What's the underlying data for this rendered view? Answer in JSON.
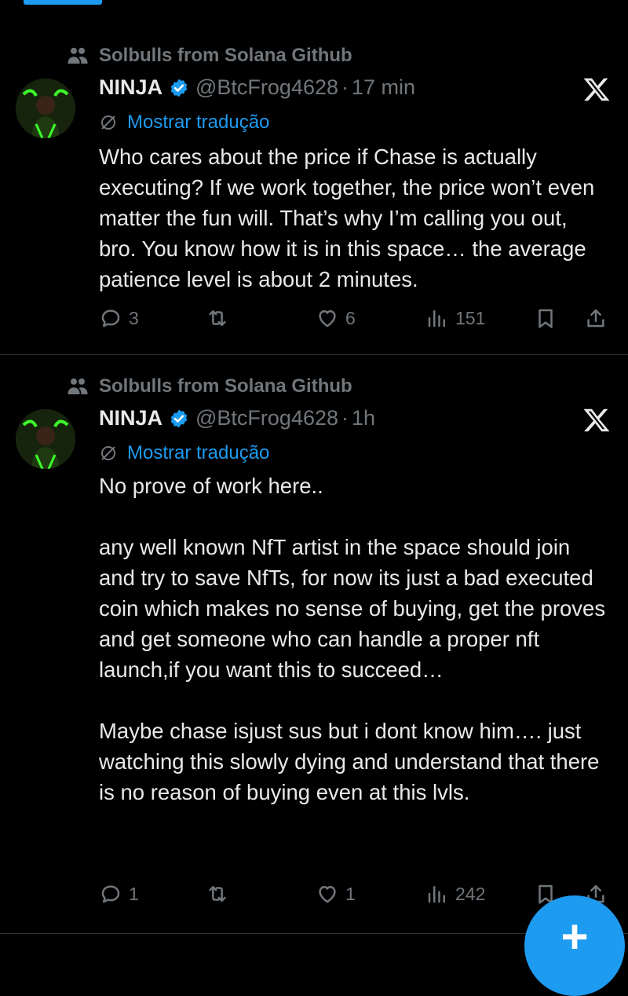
{
  "tweets": [
    {
      "social_context": "Solbulls from Solana Github",
      "name": "NINJA",
      "handle": "@BtcFrog4628",
      "separator": "·",
      "time": "17 min",
      "translate": "Mostrar tradução",
      "text": "Who cares about the price if Chase is actually executing? If we work together, the price won’t even matter the fun will. That’s why I’m calling you out, bro. You know how it is in this space… the average patience level is about 2 minutes.",
      "replies": "3",
      "retweets": "",
      "likes": "6",
      "views": "151"
    },
    {
      "social_context": "Solbulls from Solana Github",
      "name": "NINJA",
      "handle": "@BtcFrog4628",
      "separator": "·",
      "time": "1h",
      "translate": "Mostrar tradução",
      "text": "No prove of work here..\n\nany well known NfT artist in the space should join and try to save NfTs, for now its just a bad executed coin which makes no sense of buying, get the proves and get someone who can handle a proper nft launch,if you want this to succeed…\n\nMaybe chase isjust sus but i dont know him…. just watching this slowly dying and understand that there is no reason of buying even at this lvls.",
      "replies": "1",
      "retweets": "",
      "likes": "1",
      "views": "242"
    }
  ],
  "fab": {
    "label": "+"
  },
  "colors": {
    "accent": "#1d9bf0",
    "muted": "#71767b",
    "text": "#e7e9ea",
    "background": "#000000"
  },
  "icons": [
    "community-icon",
    "verified-badge-icon",
    "x-logo-icon",
    "globe-icon",
    "reply-icon",
    "retweet-icon",
    "like-icon",
    "views-icon",
    "bookmark-icon",
    "share-icon"
  ]
}
